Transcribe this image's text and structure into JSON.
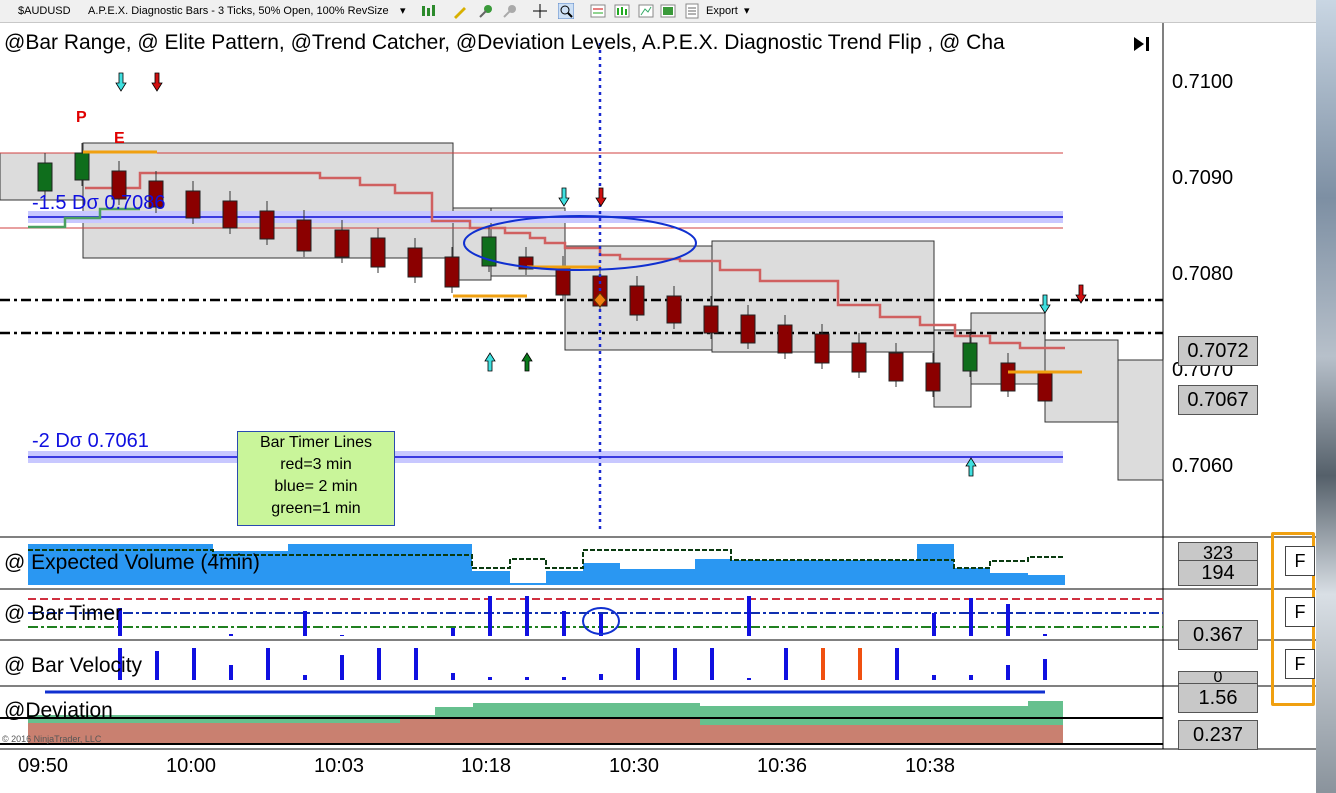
{
  "toolbar": {
    "instrument": "$AUDUSD",
    "chart_type": "A.P.E.X. Diagnostic Bars - 3 Ticks, 50% Open, 100% RevSize",
    "export_label": "Export"
  },
  "main_panel": {
    "indicators_title": "@Bar Range, @ Elite Pattern, @Trend Catcher, @Deviation Levels, A.P.E.X. Diagnostic Trend Flip , @ Cha",
    "price_axis_labels": [
      "0.7100",
      "0.7090",
      "0.7080",
      "0.7070",
      "0.7060"
    ],
    "price_markers": [
      "0.7072",
      "0.7067"
    ],
    "deviation_labels": [
      "-1.5 Dσ 0.7086",
      "-2 Dσ 0.7061"
    ],
    "pattern_letters": [
      "P",
      "E"
    ],
    "legend": {
      "title": "Bar Timer Lines",
      "lines": [
        "red=3 min",
        "blue= 2 min",
        "green=1 min"
      ]
    }
  },
  "panels": [
    {
      "title": "@ Expected Volume (4min)",
      "values": [
        "323",
        "194"
      ]
    },
    {
      "title": "@ Bar Timer",
      "values": [
        "0.367"
      ]
    },
    {
      "title": "@ Bar Velocity",
      "values": [
        "0",
        "1.56"
      ]
    },
    {
      "title": "@Deviation",
      "values": [
        "0.237"
      ]
    }
  ],
  "filter_buttons": [
    "F",
    "F",
    "F"
  ],
  "copyright": "© 2016 NinjaTrader, LLC",
  "time_axis": [
    "09:50",
    "10:00",
    "10:03",
    "10:18",
    "10:30",
    "10:36",
    "10:38"
  ],
  "colors": {
    "up_bar": "#0f6e1c",
    "down_bar": "#8b0000",
    "volume_fill": "#2a97f2",
    "deviation_green": "#66c08e",
    "deviation_red": "#c98070",
    "highlight_orange": "#f0a010",
    "deviation_band": "#8080f0"
  }
}
